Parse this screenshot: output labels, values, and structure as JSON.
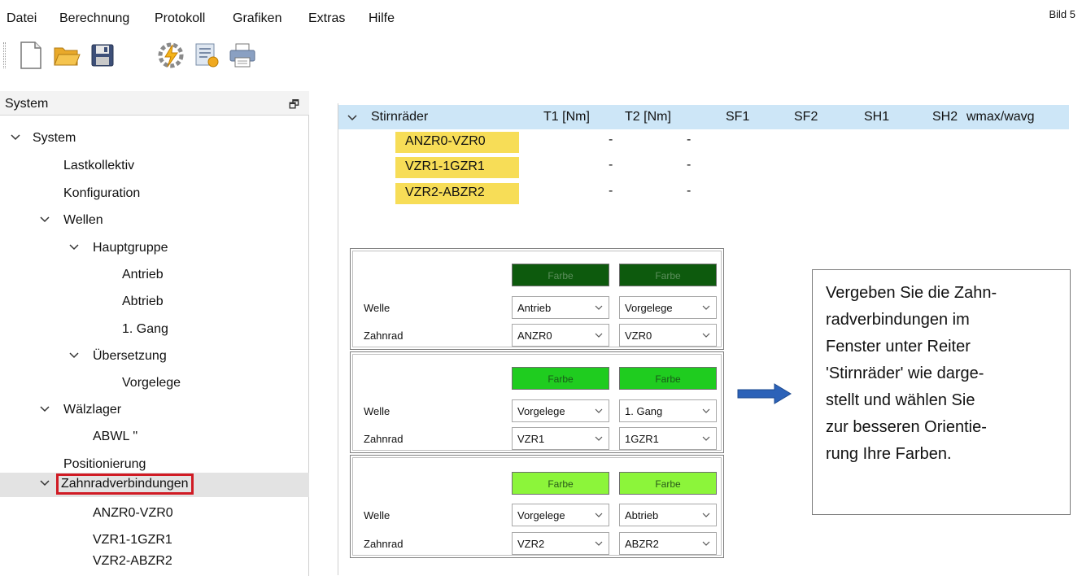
{
  "menu": {
    "items": [
      "Datei",
      "Berechnung",
      "Protokoll",
      "Grafiken",
      "Extras",
      "Hilfe"
    ],
    "figure_label": "Bild 5"
  },
  "toolbar": {
    "icons": [
      "new-document-icon",
      "open-folder-icon",
      "save-icon",
      "calculate-icon",
      "report-icon",
      "print-icon"
    ]
  },
  "left_panel": {
    "title": "System",
    "pin_icon": "window-restore-icon",
    "tree": [
      {
        "label": "System",
        "expanded": true,
        "selected": false
      },
      {
        "label": "Lastkollektiv",
        "selected": false
      },
      {
        "label": "Konfiguration",
        "selected": false
      },
      {
        "label": "Wellen",
        "expanded": true,
        "selected": false
      },
      {
        "label": "Hauptgruppe",
        "expanded": true,
        "selected": false
      },
      {
        "label": "Antrieb",
        "selected": false
      },
      {
        "label": "Abtrieb",
        "selected": false
      },
      {
        "label": "1. Gang",
        "selected": false
      },
      {
        "label": "Übersetzung",
        "expanded": true,
        "selected": false
      },
      {
        "label": "Vorgelege",
        "selected": false
      },
      {
        "label": "Wälzlager",
        "expanded": true,
        "selected": false
      },
      {
        "label": "ABWL ''",
        "selected": false
      },
      {
        "label": "Positionierung",
        "selected": false
      },
      {
        "label": "Zahnradverbindungen",
        "expanded": true,
        "selected": true
      },
      {
        "label": "ANZR0-VZR0",
        "selected": false
      },
      {
        "label": "VZR1-1GZR1",
        "selected": false
      },
      {
        "label": "VZR2-ABZR2",
        "selected": false
      }
    ]
  },
  "grid": {
    "headers": [
      "Stirnräder",
      "T1 [Nm]",
      "T2 [Nm]",
      "SF1",
      "SF2",
      "SH1",
      "SH2",
      "wmax/wavg"
    ],
    "header_bg": "#cde6f7",
    "rows": [
      {
        "name": "ANZR0-VZR0",
        "t1": "-",
        "t2": "-"
      },
      {
        "name": "VZR1-1GZR1",
        "t1": "-",
        "t2": "-"
      },
      {
        "name": "VZR2-ABZR2",
        "t1": "-",
        "t2": "-"
      }
    ],
    "tag_color": "#f7dd57"
  },
  "color_panels": [
    {
      "color_label": "Farbe",
      "color": "#0d5a0d",
      "text_color": "#5c8f5c",
      "welle_label": "Welle",
      "zahnrad_label": "Zahnrad",
      "welle_values": [
        "Antrieb",
        "Vorgelege"
      ],
      "zahnrad_values": [
        "ANZR0",
        "VZR0"
      ]
    },
    {
      "color_label": "Farbe",
      "color": "#1fcc1f",
      "text_color": "#1a5a1a",
      "welle_label": "Welle",
      "zahnrad_label": "Zahnrad",
      "welle_values": [
        "Vorgelege",
        "1. Gang"
      ],
      "zahnrad_values": [
        "VZR1",
        "1GZR1"
      ]
    },
    {
      "color_label": "Farbe",
      "color": "#8cf53a",
      "text_color": "#2a5a1a",
      "welle_label": "Welle",
      "zahnrad_label": "Zahnrad",
      "welle_values": [
        "Vorgelege",
        "Abtrieb"
      ],
      "zahnrad_values": [
        "VZR2",
        "ABZR2"
      ]
    }
  ],
  "arrow_color": "#2c62b8",
  "callout": {
    "lines": [
      "Vergeben Sie die Zahn-",
      "radverbindungen im",
      "Fenster unter Reiter",
      "'Stirnräder' wie darge-",
      "stellt und wählen Sie",
      "zur besseren Orientie-",
      "rung Ihre Farben."
    ]
  },
  "highlight_color": "#d01b24"
}
